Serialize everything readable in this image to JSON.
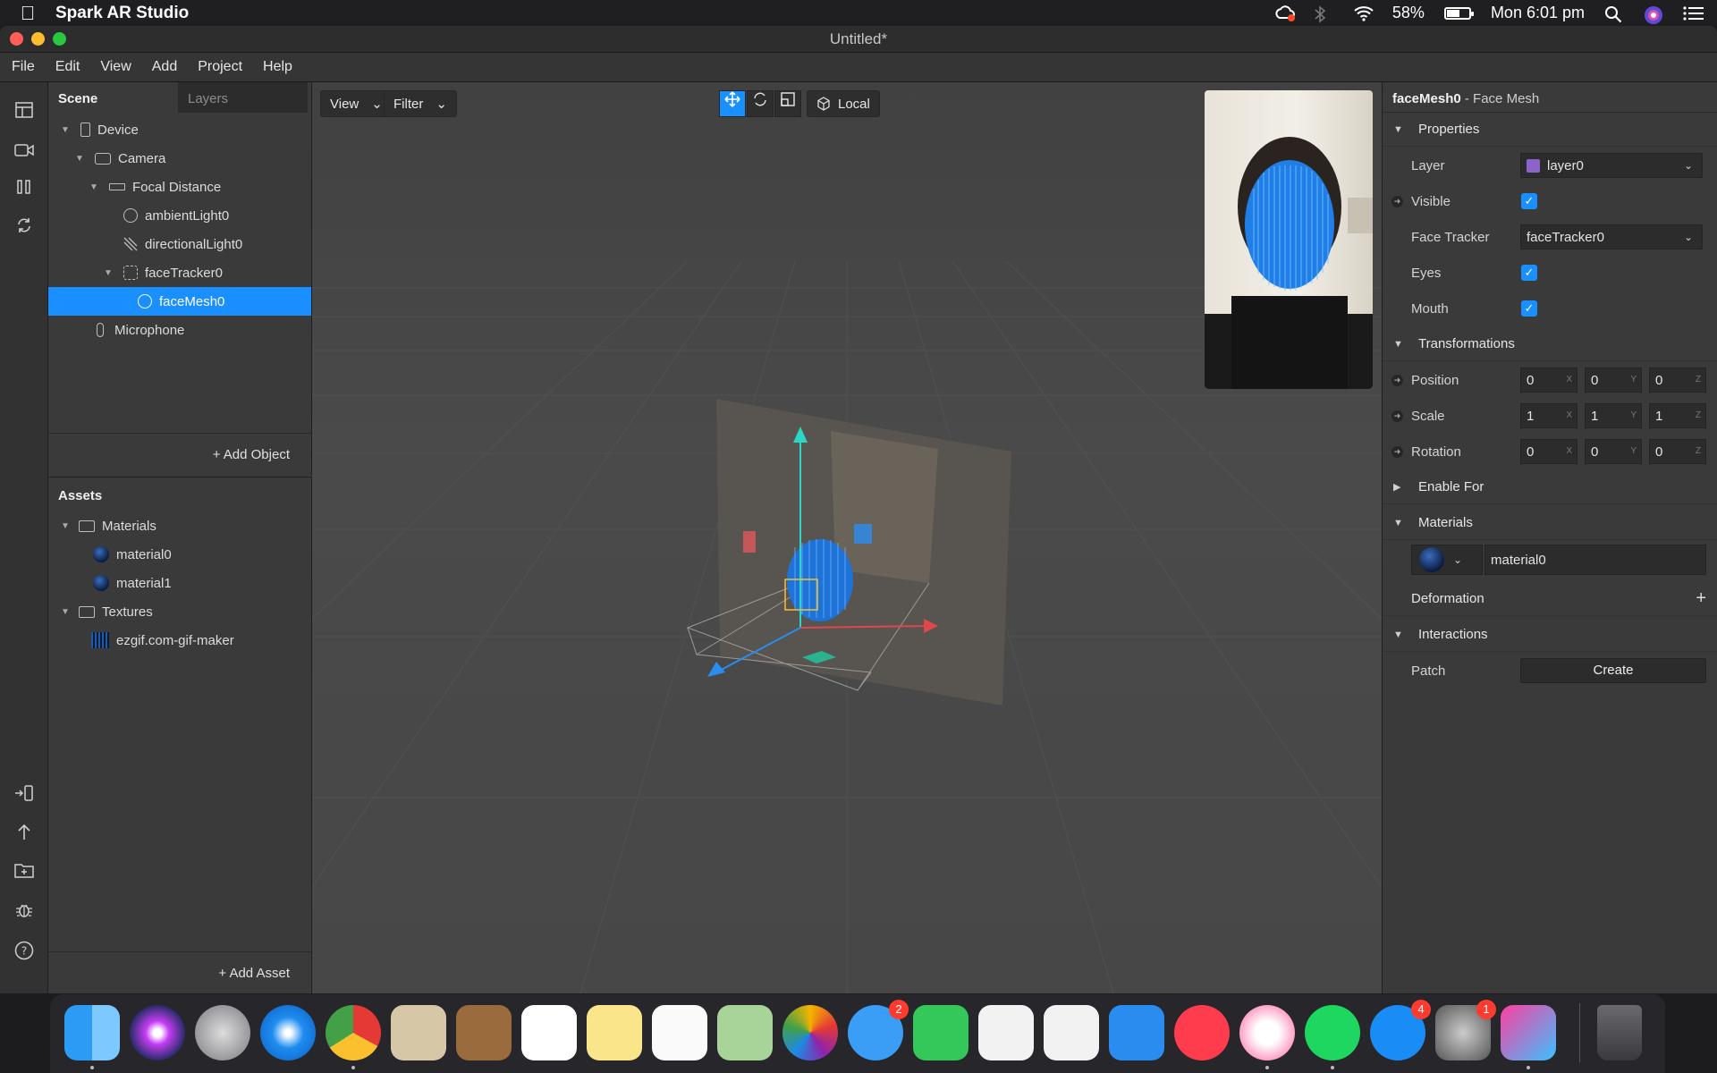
{
  "menubar": {
    "app_name": "Spark AR Studio",
    "battery": "58%",
    "clock": "Mon 6:01 pm",
    "battery_level": 0.58
  },
  "window": {
    "title": "Untitled*",
    "menu": [
      "File",
      "Edit",
      "View",
      "Add",
      "Project",
      "Help"
    ]
  },
  "scene": {
    "tabs": [
      "Scene",
      "Layers"
    ],
    "tree": [
      {
        "label": "Device",
        "icon": "phone-icon"
      },
      {
        "label": "Camera",
        "icon": "camera-icon"
      },
      {
        "label": "Focal Distance",
        "icon": "ruler-icon"
      },
      {
        "label": "ambientLight0",
        "icon": "globe-light-icon"
      },
      {
        "label": "directionalLight0",
        "icon": "directional-light-icon"
      },
      {
        "label": "faceTracker0",
        "icon": "face-tracker-icon"
      },
      {
        "label": "faceMesh0",
        "icon": "face-mesh-icon"
      },
      {
        "label": "Microphone",
        "icon": "microphone-icon"
      }
    ],
    "add_object": "+ Add Object"
  },
  "assets": {
    "title": "Assets",
    "items": [
      {
        "label": "Materials",
        "icon": "folder-icon"
      },
      {
        "label": "material0",
        "icon": "material-icon"
      },
      {
        "label": "material1",
        "icon": "material-icon"
      },
      {
        "label": "Textures",
        "icon": "folder-icon"
      },
      {
        "label": "ezgif.com-gif-maker",
        "icon": "texture-icon"
      }
    ],
    "add_asset": "+ Add Asset"
  },
  "viewport": {
    "view_label": "View",
    "filter_label": "Filter",
    "space_label": "Local"
  },
  "inspector": {
    "object_name": "faceMesh0",
    "object_type": "- Face Mesh",
    "sections": {
      "properties": "Properties",
      "transformations": "Transformations",
      "enable_for": "Enable For",
      "materials": "Materials",
      "deformation": "Deformation",
      "interactions": "Interactions"
    },
    "props": {
      "layer_label": "Layer",
      "layer_value": "layer0",
      "visible_label": "Visible",
      "face_tracker_label": "Face Tracker",
      "face_tracker_value": "faceTracker0",
      "eyes_label": "Eyes",
      "mouth_label": "Mouth",
      "position_label": "Position",
      "scale_label": "Scale",
      "rotation_label": "Rotation",
      "material_value": "material0",
      "patch_label": "Patch",
      "create_label": "Create"
    },
    "position": [
      "0",
      "0",
      "0"
    ],
    "scale": [
      "1",
      "1",
      "1"
    ],
    "rotation": [
      "0",
      "0",
      "0"
    ],
    "axes": [
      "X",
      "Y",
      "Z"
    ],
    "plus": "+"
  },
  "colors": {
    "accent": "#1a8fff",
    "layer_swatch": "#8e63c9"
  },
  "dock": {
    "badges": {
      "messages": "2",
      "app_store": "4",
      "system_prefs": "1"
    }
  }
}
